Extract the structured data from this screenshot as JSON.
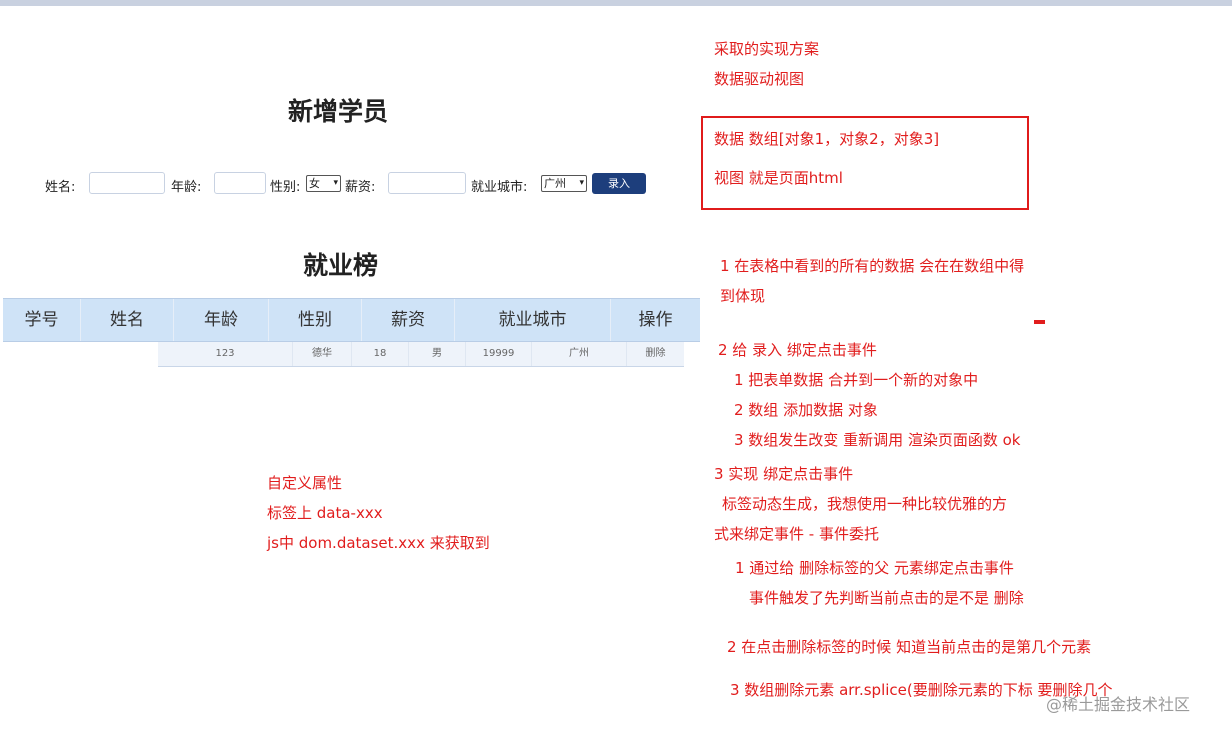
{
  "form": {
    "title": "新增学员",
    "name_label": "姓名:",
    "age_label": "年龄:",
    "gender_label": "性别:",
    "gender_value": "女",
    "salary_label": "薪资:",
    "city_label": "就业城市:",
    "city_value": "广州",
    "submit_label": "录入"
  },
  "table": {
    "title": "就业榜",
    "headers": [
      "学号",
      "姓名",
      "年龄",
      "性别",
      "薪资",
      "就业城市",
      "操作"
    ],
    "row": [
      "123",
      "德华",
      "18",
      "男",
      "19999",
      "广州",
      "删除"
    ]
  },
  "notes": {
    "approach_1": "采取的实现方案",
    "approach_2": "数据驱动视图",
    "box_data": "数据   数组[对象1，对象2，对象3]",
    "box_view": "视图   就是页面html",
    "p1_a": "1 在表格中看到的所有的数据 会在在数组中得",
    "p1_b": "到体现",
    "p2": "2 给 录入 绑定点击事件",
    "p2_1": "1 把表单数据 合并到一个新的对象中",
    "p2_2": "2 数组 添加数据 对象",
    "p2_3": "3 数组发生改变 重新调用 渲染页面函数 ok",
    "p3": "3 实现 绑定点击事件",
    "p3_a": "标签动态生成，我想使用一种比较优雅的方",
    "p3_b": "式来绑定事件 -    事件委托",
    "p3_1": "1 通过给 删除标签的父 元素绑定点击事件",
    "p3_1b": "事件触发了先判断当前点击的是不是 删除",
    "p3_2": "2 在点击删除标签的时候 知道当前点击的是第几个元素",
    "p3_3": "3 数组删除元素      arr.splice(要删除元素的下标       要删除几个",
    "attr_1": "自定义属性",
    "attr_2": "标签上 data-xxx",
    "attr_3": "js中 dom.dataset.xxx 来获取到"
  },
  "watermark": "@稀土掘金技术社区",
  "colors": {
    "note_red": "#e11d1d",
    "header_blue": "#cfe3f7",
    "button_navy": "#1d3e7c"
  }
}
